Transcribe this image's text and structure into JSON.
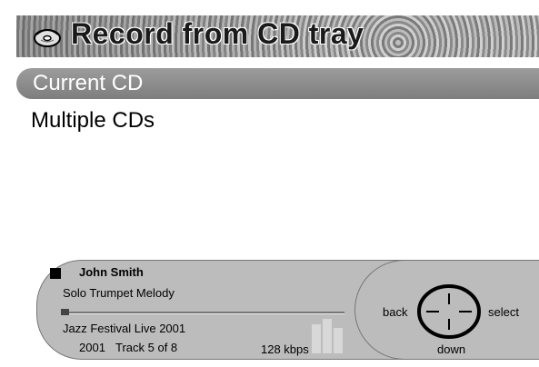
{
  "header": {
    "title": "Record from CD tray",
    "icon": "cd-record-icon"
  },
  "menu": {
    "items": [
      {
        "label": "Current CD",
        "selected": true
      },
      {
        "label": "Multiple CDs",
        "selected": false
      }
    ]
  },
  "now_playing": {
    "state_icon": "stop-icon",
    "artist": "John Smith",
    "track_title": "Solo Trumpet Melody",
    "album": "Jazz Festival Live 2001",
    "year": "2001",
    "track_info": "Track 5 of 8",
    "bitrate": "128 kbps",
    "progress_fraction": 0.03
  },
  "navigation": {
    "back_label": "back",
    "select_label": "select",
    "down_label": "down"
  },
  "colors": {
    "highlight": "#8c8c8c",
    "panel": "#bcbcbc"
  }
}
